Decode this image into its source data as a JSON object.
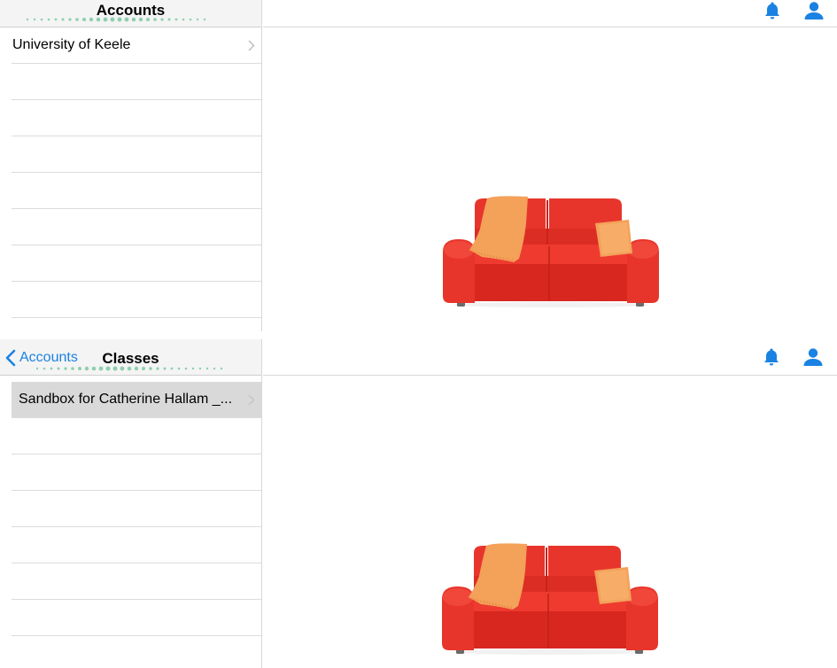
{
  "colors": {
    "accent_blue": "#1a82e2",
    "nav_bg": "#f4f4f4",
    "selected_row": "#d9d9d9",
    "sofa_red": "#e8352b",
    "sofa_dark_red": "#c9221c",
    "throw_orange": "#f4a15a",
    "dots_green": "#8fcfb0"
  },
  "icons": {
    "notifications": "bell-icon",
    "profile": "user-icon",
    "disclosure": "chevron-right-icon",
    "back": "chevron-left-icon",
    "empty_state": "sofa-icon"
  },
  "top_screen": {
    "nav": {
      "title": "Accounts"
    },
    "list": {
      "items": [
        {
          "label": "University of Keele"
        }
      ],
      "empty_rows": 7
    }
  },
  "bottom_screen": {
    "nav": {
      "back_label": "Accounts",
      "title": "Classes"
    },
    "list": {
      "items": [
        {
          "label": "Sandbox for Catherine Hallam _...",
          "selected": true
        }
      ],
      "empty_rows": 7
    }
  }
}
